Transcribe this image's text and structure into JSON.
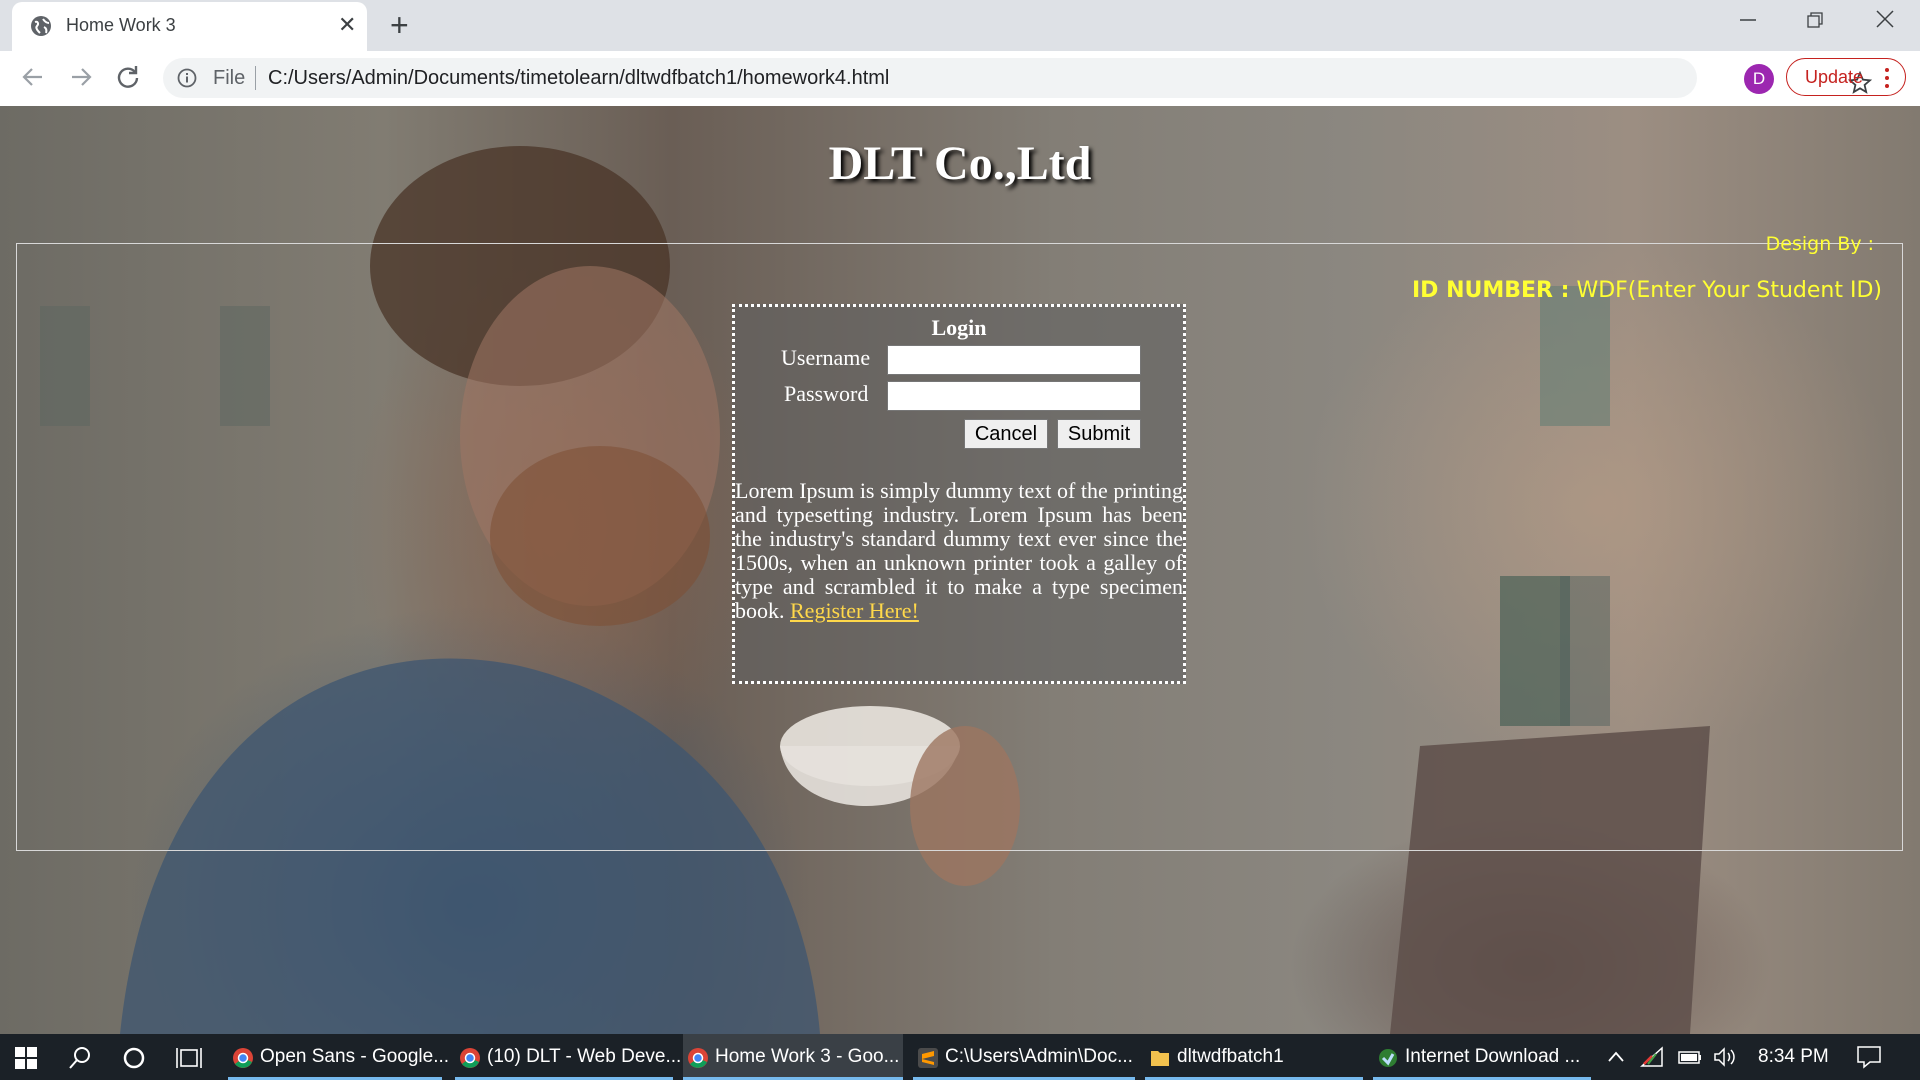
{
  "browser": {
    "tab_title": "Home Work 3",
    "address_scheme_label": "File",
    "url": "C:/Users/Admin/Documents/timetolearn/dltwdfbatch1/homework4.html",
    "profile_initial": "D",
    "update_label": "Update"
  },
  "page": {
    "title": "DLT Co.,Ltd",
    "design_by": "Design By :",
    "id_key": "ID NUMBER :",
    "id_value": "WDF(Enter Your Student ID)",
    "login": {
      "heading": "Login",
      "username_label": "Username",
      "password_label": "Password",
      "username_value": "",
      "password_value": "",
      "cancel_label": "Cancel",
      "submit_label": "Submit"
    },
    "lorem": "Lorem Ipsum is simply dummy text of the printing and typesetting industry. Lorem Ipsum has been the industry's standard dummy text ever since the 1500s, when an unknown printer took a galley of type and scrambled it to make a type specimen book.",
    "register_link": "Register Here!"
  },
  "taskbar": {
    "apps": [
      {
        "label": "Open Sans - Google...",
        "icon": "chrome-icon"
      },
      {
        "label": "(10) DLT - Web Deve...",
        "icon": "chrome-icon"
      },
      {
        "label": "Home Work 3 - Goo...",
        "icon": "chrome-icon"
      },
      {
        "label": "C:\\Users\\Admin\\Doc...",
        "icon": "sublime-icon"
      },
      {
        "label": "dltwdfbatch1",
        "icon": "folder-icon"
      },
      {
        "label": "Internet Download ...",
        "icon": "idm-icon"
      }
    ],
    "time": "8:34 PM"
  },
  "colors": {
    "accent_yellow": "#ffff33",
    "link_color": "#ffd84a",
    "taskbar_bg": "#1b2127",
    "avatar_bg": "#9c27b0",
    "update_red": "#c5221f"
  }
}
